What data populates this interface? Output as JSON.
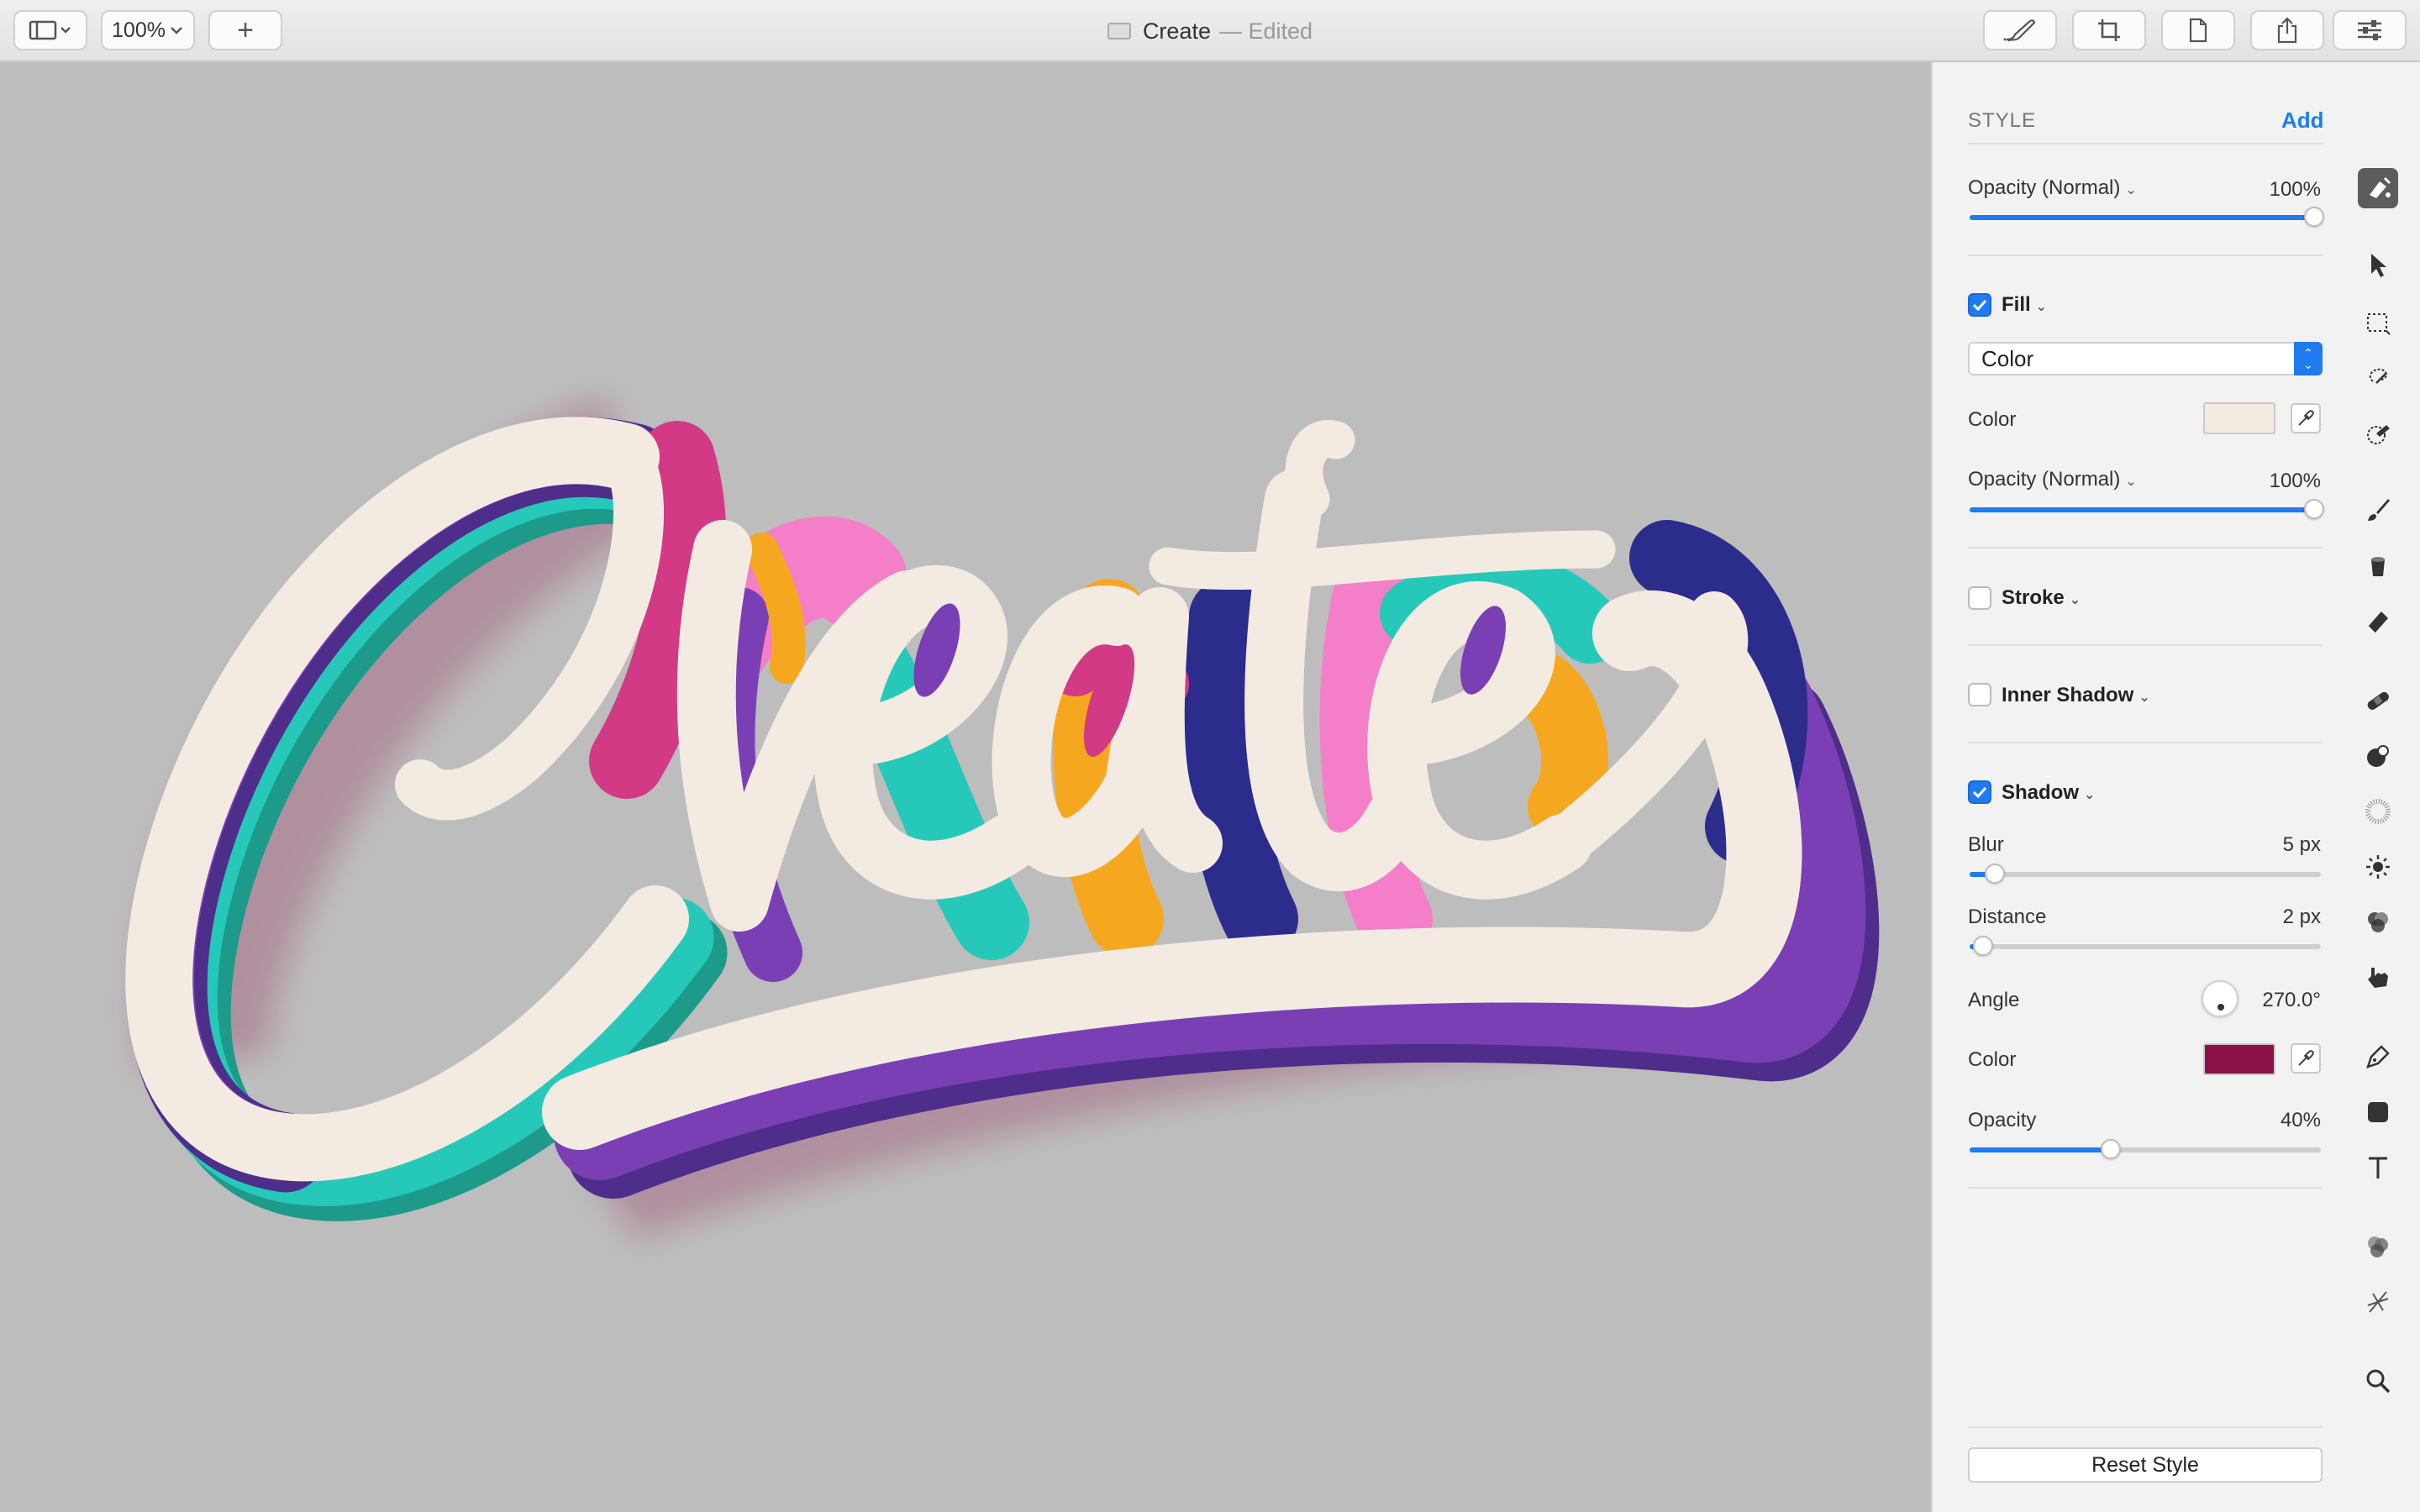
{
  "window": {
    "title": "Create",
    "title_status": "— Edited"
  },
  "toolbar": {
    "zoom": "100%",
    "add": "+"
  },
  "sidebar": {
    "heading": "STYLE",
    "add_link": "Add",
    "layer_opacity": {
      "label": "Opacity (Normal)",
      "value": "100%",
      "fraction": 1.0
    },
    "fill": {
      "label": "Fill",
      "checked": true,
      "type": "Color",
      "color_label": "Color",
      "color": "#f3ebe2",
      "opacity_label": "Opacity (Normal)",
      "opacity_value": "100%",
      "opacity_fraction": 1.0
    },
    "stroke": {
      "label": "Stroke",
      "checked": false
    },
    "inner_shadow": {
      "label": "Inner Shadow",
      "checked": false
    },
    "shadow": {
      "label": "Shadow",
      "checked": true,
      "blur_label": "Blur",
      "blur_value": "5 px",
      "blur_fraction": 0.07,
      "distance_label": "Distance",
      "distance_value": "2 px",
      "distance_fraction": 0.04,
      "angle_label": "Angle",
      "angle_value": "270.0°",
      "color_label": "Color",
      "color": "#8c1147",
      "opacity_label": "Opacity",
      "opacity_value": "40%",
      "opacity_fraction": 0.4
    },
    "reset_button": "Reset Style"
  },
  "tools": [
    "style-icon",
    "arrow-icon",
    "rect-select-icon",
    "lasso-icon",
    "magic-select-icon",
    "brush-icon",
    "bucket-icon",
    "eraser-icon",
    "bandage-icon",
    "clone-icon",
    "noise-icon",
    "brightness-icon",
    "color-adjust-icon",
    "smudge-icon",
    "pen-icon",
    "shape-icon",
    "text-icon",
    "blend-icon",
    "sparkle-icon",
    "zoom-icon"
  ],
  "colors": {
    "accent": "#1f7bef",
    "cream": "#f3ebe2",
    "purple": "#7b3fb5",
    "teal": "#26c9b9",
    "pink": "#f47fc8",
    "magenta": "#d23a85",
    "orange": "#f5a81f",
    "navy": "#2b2c8c"
  }
}
